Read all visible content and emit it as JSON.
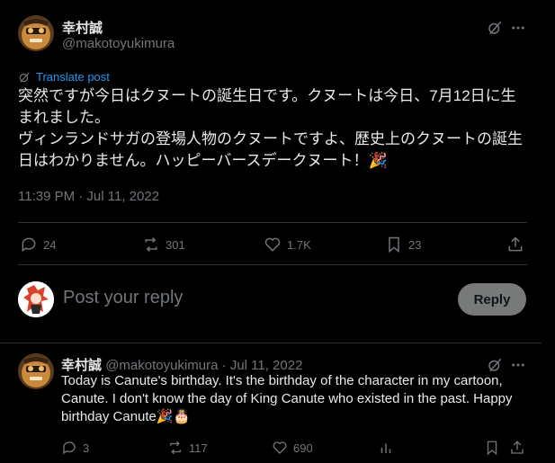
{
  "post": {
    "author_name": "幸村誠",
    "author_handle": "@makotoyukimura",
    "translate_label": "Translate post",
    "text_paragraphs": [
      "突然ですが今日はクヌートの誕生日です。クヌートは今日、7月12日に生まれました。",
      "ヴィンランドサガの登場人物のクヌートですよ、歴史上のクヌートの誕生日はわかりません。ハッピーバースデークヌート！🎉"
    ],
    "timestamp": "11:39 PM · Jul 11, 2022",
    "stats": {
      "replies": "24",
      "reposts": "301",
      "likes": "1.7K",
      "bookmarks": "23"
    }
  },
  "reply_box": {
    "placeholder": "Post your reply",
    "button_label": "Reply"
  },
  "comment": {
    "author_name": "幸村誠",
    "author_handle": "@makotoyukimura",
    "separator": "·",
    "date": "Jul 11, 2022",
    "text": "Today is Canute's birthday. It's the birthday of the character in my cartoon, Canute. I don't know the day of King Canute who existed in the past. Happy birthday Canute🎉🎂",
    "stats": {
      "replies": "3",
      "reposts": "117",
      "likes": "690"
    }
  },
  "colors": {
    "background": "#000000",
    "text": "#e7e9ea",
    "muted": "#71767b",
    "link": "#1d9bf0",
    "divider": "#2f3336",
    "reply_button_bg": "#787a7a"
  },
  "icons": {
    "grok": "grok-icon",
    "more": "more-icon",
    "translate": "translate-icon",
    "reply": "reply-icon",
    "repost": "repost-icon",
    "like": "like-icon",
    "bookmark": "bookmark-icon",
    "share": "share-icon",
    "views": "views-icon"
  }
}
